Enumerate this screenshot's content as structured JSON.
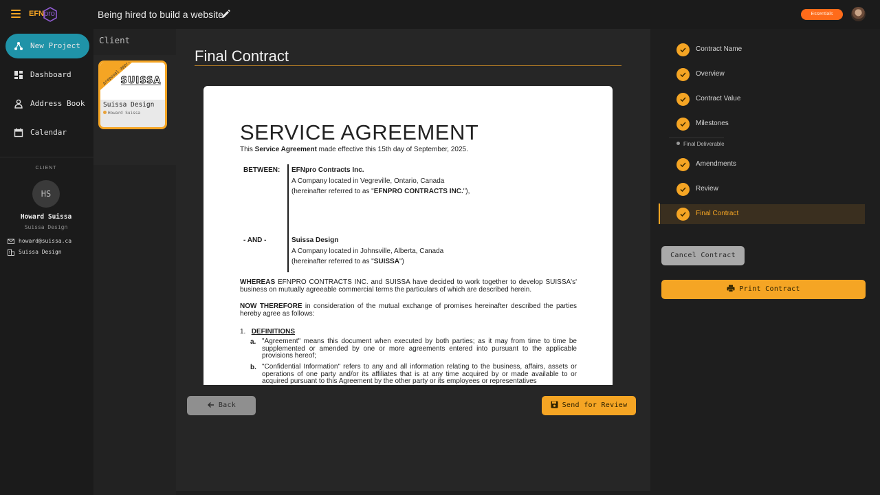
{
  "header": {
    "logo_text": "EFN",
    "logo_suffix": "pro",
    "project_title": "Being hired to build a website",
    "plan_badge": "Essentials"
  },
  "sidebar": {
    "items": [
      {
        "label": "New Project",
        "icon": "hub-icon",
        "active": true
      },
      {
        "label": "Dashboard",
        "icon": "dashboard-icon",
        "active": false
      },
      {
        "label": "Address Book",
        "icon": "person-icon",
        "active": false
      },
      {
        "label": "Calendar",
        "icon": "calendar-icon",
        "active": false
      }
    ],
    "client_heading": "CLIENT",
    "client_initials": "HS",
    "client_name": "Howard Suissa",
    "client_company": "Suissa Design",
    "client_email": "howard@suissa.ca",
    "client_org": "Suissa Design"
  },
  "client_column": {
    "title": "Client",
    "card": {
      "ribbon": "proposal approv",
      "logo_text": "SUISSA",
      "name": "Suissa Design",
      "contact": "Howard Suissa"
    }
  },
  "main": {
    "title": "Final Contract",
    "document": {
      "heading": "SERVICE AGREEMENT",
      "intro_prefix": "This ",
      "intro_bold": "Service Agreement",
      "intro_suffix": " made effective this 15th day of September, 2025.",
      "between_label": "BETWEEN:",
      "party1_name": "EFNpro Contracts Inc.",
      "party1_location": "A Company located in Vegreville, Ontario, Canada",
      "party1_ref_prefix": "(hereinafter referred to as \"",
      "party1_ref_bold": "EFNPRO CONTRACTS INC.",
      "party1_ref_suffix": "\"),",
      "and_label": "- AND -",
      "party2_name": "Suissa Design",
      "party2_location": "A Company located in Johnsville, Alberta, Canada",
      "party2_ref_prefix": "(hereinafter referred to as \"",
      "party2_ref_bold": "SUISSA",
      "party2_ref_suffix": "\")",
      "whereas_bold": "WHEREAS",
      "whereas_text": " EFNPRO CONTRACTS INC. and SUISSA have decided to work together to develop SUISSA's' business on mutually agreeable commercial terms the particulars of which are described herein.",
      "now_bold": "NOW THEREFORE",
      "now_text": " in consideration of the mutual exchange of promises hereinafter described the parties hereby agree as follows:",
      "section_number": "1.",
      "section_title": "DEFINITIONS",
      "item_a_label": "a.",
      "item_a_text": "\"Agreement\" means this document when executed by both parties; as it may from time to time be supplemented or amended by one or more agreements entered into pursuant to the applicable provisions hereof;",
      "item_b_label": "b.",
      "item_b_text": "\"Confidential Information\" refers to any and all information relating to the business, affairs, assets or operations of one party and/or its affiliates that is at any time acquired by or made available to or acquired pursuant to this Agreement by the other party or its employees or representatives"
    },
    "back_label": "Back",
    "review_label": "Send for Review"
  },
  "steps": {
    "items": [
      {
        "label": "Contract Name"
      },
      {
        "label": "Overview"
      },
      {
        "label": "Contract Value"
      },
      {
        "label": "Milestones"
      },
      {
        "label": "Amendments"
      },
      {
        "label": "Review"
      },
      {
        "label": "Final Contract"
      }
    ],
    "substep": "Final Deliverable",
    "cancel_label": "Cancel Contract",
    "print_label": "Print Contract"
  },
  "colors": {
    "accent": "#f5a524",
    "teal": "#1f93a8",
    "badge": "#ff6b1a",
    "background": "#1e1e1e"
  }
}
